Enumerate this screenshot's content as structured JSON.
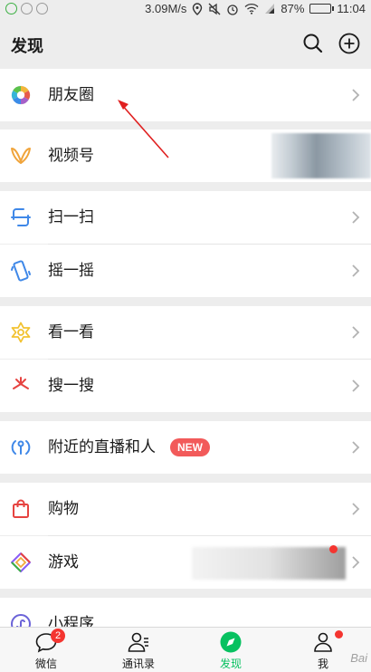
{
  "status_bar": {
    "speed": "3.09M/s",
    "battery": "87%",
    "battery_level": 0.87,
    "time": "11:04"
  },
  "header": {
    "title": "发现",
    "search_icon": "search-icon",
    "add_icon": "plus-circle-icon"
  },
  "items": {
    "moments": {
      "label": "朋友圈",
      "icon": "aperture-icon"
    },
    "channels": {
      "label": "视频号",
      "icon": "butterfly-icon"
    },
    "scan": {
      "label": "扫一扫",
      "icon": "scan-icon"
    },
    "shake": {
      "label": "摇一摇",
      "icon": "shake-icon"
    },
    "top_stories": {
      "label": "看一看",
      "icon": "sparkle-icon"
    },
    "search": {
      "label": "搜一搜",
      "icon": "star-search-icon"
    },
    "nearby_live": {
      "label": "附近的直播和人",
      "icon": "location-person-icon",
      "badge": "NEW"
    },
    "shopping": {
      "label": "购物",
      "icon": "shopping-bag-icon"
    },
    "games": {
      "label": "游戏",
      "icon": "game-diamond-icon"
    },
    "mini_programs": {
      "label": "小程序",
      "icon": "mini-program-icon"
    }
  },
  "tab_bar": {
    "chats": {
      "label": "微信",
      "badge": "2"
    },
    "contacts": {
      "label": "通讯录"
    },
    "discover": {
      "label": "发现"
    },
    "me": {
      "label": "我"
    }
  },
  "colors": {
    "accent": "#07c160",
    "badge_red": "#f43530",
    "background": "#ededed"
  },
  "watermark": "Bai"
}
